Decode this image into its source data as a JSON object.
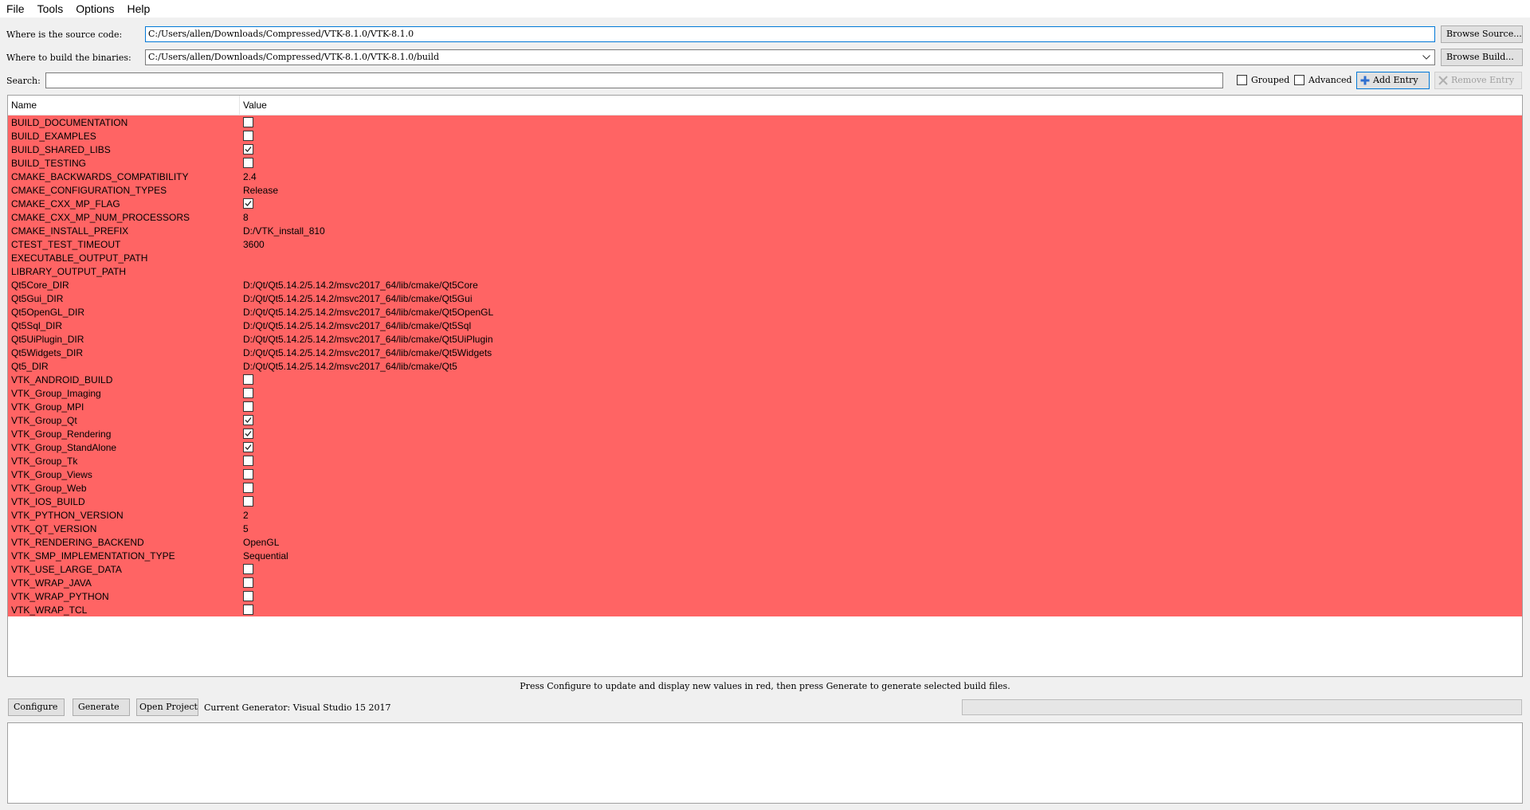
{
  "menu": [
    "File",
    "Tools",
    "Options",
    "Help"
  ],
  "source": {
    "label": "Where is the source code:",
    "value": "C:/Users/allen/Downloads/Compressed/VTK-8.1.0/VTK-8.1.0",
    "browse": "Browse Source..."
  },
  "build": {
    "label": "Where to build the binaries:",
    "value": "C:/Users/allen/Downloads/Compressed/VTK-8.1.0/VTK-8.1.0/build",
    "browse": "Browse Build..."
  },
  "search": {
    "label": "Search:",
    "value": "",
    "grouped_label": "Grouped",
    "grouped_checked": false,
    "advanced_label": "Advanced",
    "advanced_checked": false,
    "add_entry": "Add Entry",
    "remove_entry": "Remove Entry"
  },
  "table": {
    "columns": [
      "Name",
      "Value"
    ],
    "row_color": "#ff6464",
    "rows": [
      {
        "name": "BUILD_DOCUMENTATION",
        "type": "bool",
        "checked": false
      },
      {
        "name": "BUILD_EXAMPLES",
        "type": "bool",
        "checked": false
      },
      {
        "name": "BUILD_SHARED_LIBS",
        "type": "bool",
        "checked": true
      },
      {
        "name": "BUILD_TESTING",
        "type": "bool",
        "checked": false
      },
      {
        "name": "CMAKE_BACKWARDS_COMPATIBILITY",
        "type": "text",
        "value": "2.4"
      },
      {
        "name": "CMAKE_CONFIGURATION_TYPES",
        "type": "text",
        "value": "Release"
      },
      {
        "name": "CMAKE_CXX_MP_FLAG",
        "type": "bool",
        "checked": true
      },
      {
        "name": "CMAKE_CXX_MP_NUM_PROCESSORS",
        "type": "text",
        "value": "8"
      },
      {
        "name": "CMAKE_INSTALL_PREFIX",
        "type": "text",
        "value": "D:/VTK_install_810"
      },
      {
        "name": "CTEST_TEST_TIMEOUT",
        "type": "text",
        "value": "3600"
      },
      {
        "name": "EXECUTABLE_OUTPUT_PATH",
        "type": "text",
        "value": ""
      },
      {
        "name": "LIBRARY_OUTPUT_PATH",
        "type": "text",
        "value": ""
      },
      {
        "name": "Qt5Core_DIR",
        "type": "text",
        "value": "D:/Qt/Qt5.14.2/5.14.2/msvc2017_64/lib/cmake/Qt5Core"
      },
      {
        "name": "Qt5Gui_DIR",
        "type": "text",
        "value": "D:/Qt/Qt5.14.2/5.14.2/msvc2017_64/lib/cmake/Qt5Gui"
      },
      {
        "name": "Qt5OpenGL_DIR",
        "type": "text",
        "value": "D:/Qt/Qt5.14.2/5.14.2/msvc2017_64/lib/cmake/Qt5OpenGL"
      },
      {
        "name": "Qt5Sql_DIR",
        "type": "text",
        "value": "D:/Qt/Qt5.14.2/5.14.2/msvc2017_64/lib/cmake/Qt5Sql"
      },
      {
        "name": "Qt5UiPlugin_DIR",
        "type": "text",
        "value": "D:/Qt/Qt5.14.2/5.14.2/msvc2017_64/lib/cmake/Qt5UiPlugin"
      },
      {
        "name": "Qt5Widgets_DIR",
        "type": "text",
        "value": "D:/Qt/Qt5.14.2/5.14.2/msvc2017_64/lib/cmake/Qt5Widgets"
      },
      {
        "name": "Qt5_DIR",
        "type": "text",
        "value": "D:/Qt/Qt5.14.2/5.14.2/msvc2017_64/lib/cmake/Qt5"
      },
      {
        "name": "VTK_ANDROID_BUILD",
        "type": "bool",
        "checked": false
      },
      {
        "name": "VTK_Group_Imaging",
        "type": "bool",
        "checked": false
      },
      {
        "name": "VTK_Group_MPI",
        "type": "bool",
        "checked": false
      },
      {
        "name": "VTK_Group_Qt",
        "type": "bool",
        "checked": true
      },
      {
        "name": "VTK_Group_Rendering",
        "type": "bool",
        "checked": true
      },
      {
        "name": "VTK_Group_StandAlone",
        "type": "bool",
        "checked": true
      },
      {
        "name": "VTK_Group_Tk",
        "type": "bool",
        "checked": false
      },
      {
        "name": "VTK_Group_Views",
        "type": "bool",
        "checked": false
      },
      {
        "name": "VTK_Group_Web",
        "type": "bool",
        "checked": false
      },
      {
        "name": "VTK_IOS_BUILD",
        "type": "bool",
        "checked": false
      },
      {
        "name": "VTK_PYTHON_VERSION",
        "type": "text",
        "value": "2"
      },
      {
        "name": "VTK_QT_VERSION",
        "type": "text",
        "value": "5"
      },
      {
        "name": "VTK_RENDERING_BACKEND",
        "type": "text",
        "value": "OpenGL"
      },
      {
        "name": "VTK_SMP_IMPLEMENTATION_TYPE",
        "type": "text",
        "value": "Sequential"
      },
      {
        "name": "VTK_USE_LARGE_DATA",
        "type": "bool",
        "checked": false
      },
      {
        "name": "VTK_WRAP_JAVA",
        "type": "bool",
        "checked": false
      },
      {
        "name": "VTK_WRAP_PYTHON",
        "type": "bool",
        "checked": false
      },
      {
        "name": "VTK_WRAP_TCL",
        "type": "bool",
        "checked": false
      }
    ]
  },
  "hint": "Press Configure to update and display new values in red, then press Generate to generate selected build files.",
  "actions": {
    "configure": "Configure",
    "generate": "Generate",
    "open_project": "Open Project",
    "generator": "Current Generator: Visual Studio 15 2017"
  },
  "progress": 0,
  "output_log": ""
}
